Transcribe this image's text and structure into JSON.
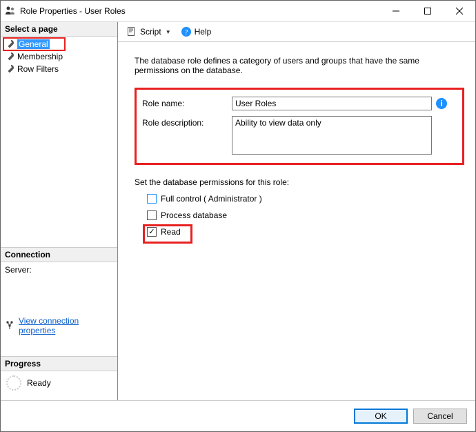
{
  "window": {
    "title": "Role Properties - User Roles"
  },
  "sidebar": {
    "select_page_header": "Select a page",
    "pages": [
      {
        "label": "General",
        "selected": true
      },
      {
        "label": "Membership",
        "selected": false
      },
      {
        "label": "Row Filters",
        "selected": false
      }
    ],
    "connection_header": "Connection",
    "server_label": "Server:",
    "view_connection_link": "View connection properties",
    "progress_header": "Progress",
    "progress_status": "Ready"
  },
  "toolbar": {
    "script_label": "Script",
    "help_label": "Help"
  },
  "main": {
    "intro": "The database role defines a category of users and groups that have the same permissions on the database.",
    "role_name_label": "Role name:",
    "role_name_value": "User Roles",
    "role_desc_label": "Role description:",
    "role_desc_value": "Ability to view data only",
    "perm_title": "Set the database permissions for this role:",
    "perm_full": "Full control ( Administrator )",
    "perm_process": "Process database",
    "perm_read": "Read"
  },
  "footer": {
    "ok": "OK",
    "cancel": "Cancel"
  }
}
